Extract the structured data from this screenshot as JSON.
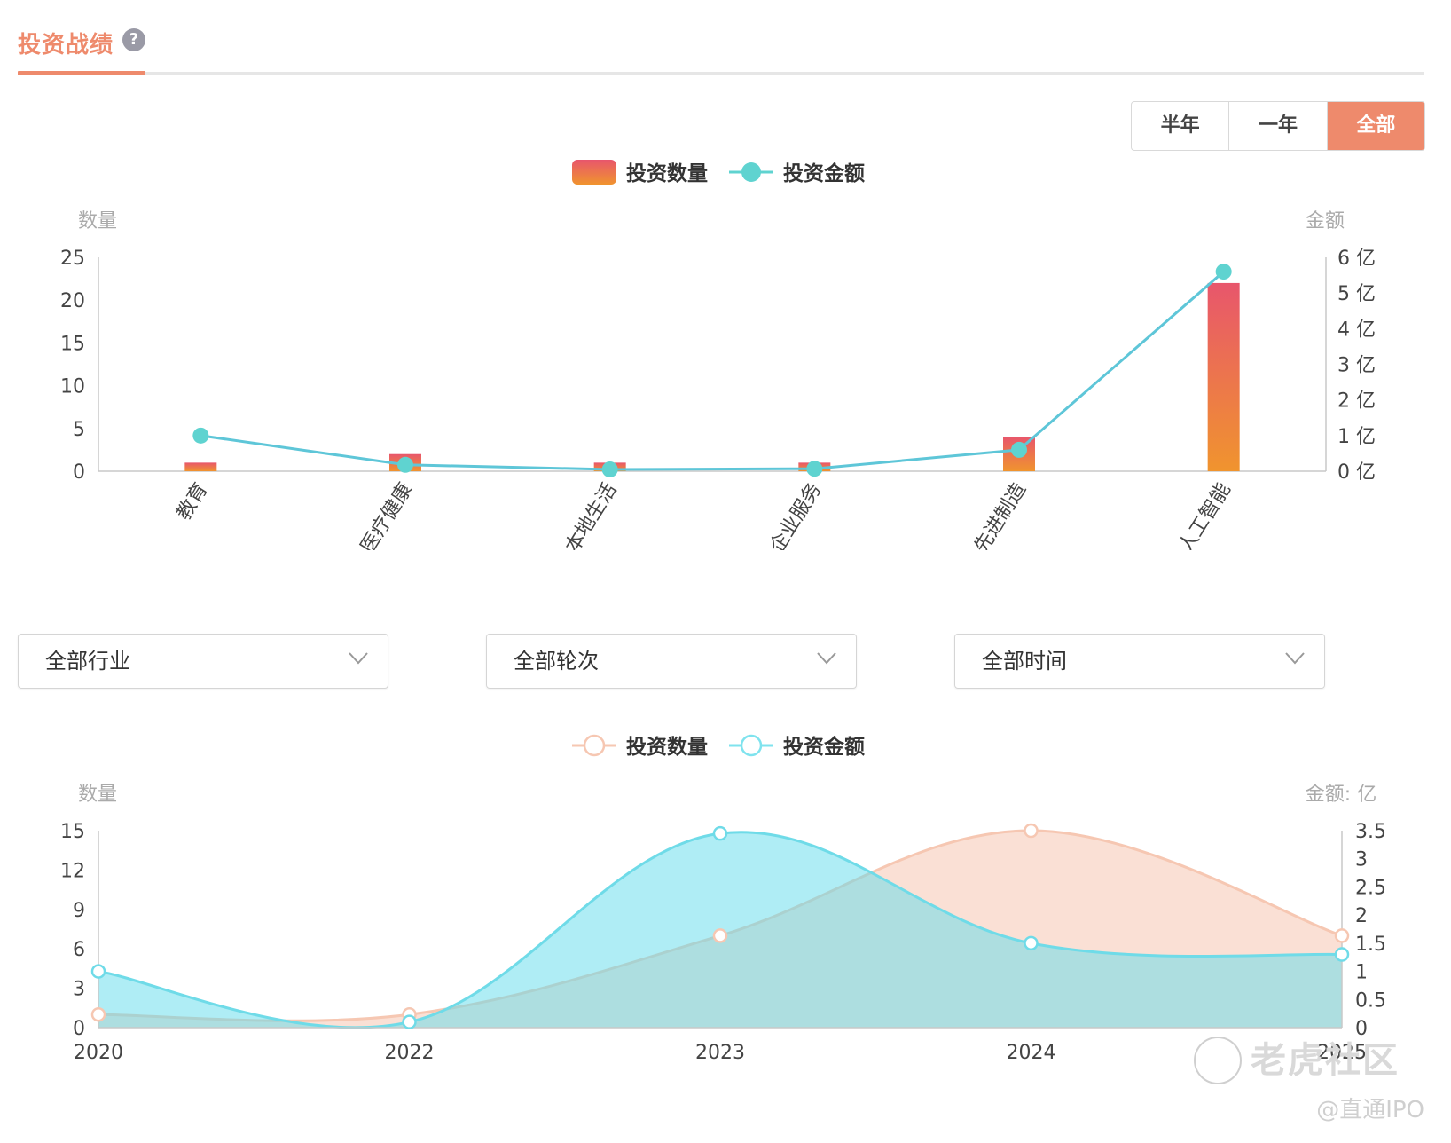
{
  "header": {
    "title": "投资战绩",
    "help_icon": "?"
  },
  "range_tabs": [
    {
      "label": "半年",
      "active": false
    },
    {
      "label": "一年",
      "active": false
    },
    {
      "label": "全部",
      "active": true
    }
  ],
  "filters": [
    {
      "label": "全部行业"
    },
    {
      "label": "全部轮次"
    },
    {
      "label": "全部时间"
    }
  ],
  "colors": {
    "accent": "#ee8a6c",
    "bar_top": "#e8566c",
    "bar_bottom": "#f0942e",
    "amount_line": "#5fd3d0",
    "count_area": "#f6c7b2",
    "amount_area": "#7fe3ee"
  },
  "watermark": {
    "brand": "老虎社区",
    "handle": "@直通IPO"
  },
  "chart_data": [
    {
      "type": "bar",
      "legend": [
        "投资数量",
        "投资金额"
      ],
      "ylabel_left": "数量",
      "ylabel_right": "金额",
      "ylim_left": [
        0,
        25
      ],
      "ylim_right": [
        0,
        6
      ],
      "left_ticks": [
        "0",
        "5",
        "10",
        "15",
        "20",
        "25"
      ],
      "right_ticks": [
        "0 亿",
        "1 亿",
        "2 亿",
        "3 亿",
        "4 亿",
        "5 亿",
        "6 亿"
      ],
      "categories": [
        "教育",
        "医疗健康",
        "本地生活",
        "企业服务",
        "先进制造",
        "人工智能"
      ],
      "series": [
        {
          "name": "投资数量",
          "type": "bar",
          "values": [
            1,
            2,
            1,
            1,
            4,
            22
          ]
        },
        {
          "name": "投资金额",
          "type": "line",
          "values": [
            1.0,
            0.18,
            0.05,
            0.07,
            0.6,
            5.6
          ]
        }
      ],
      "legend_position": "top-center",
      "grid": false
    },
    {
      "type": "area",
      "legend": [
        "投资数量",
        "投资金额"
      ],
      "ylabel_left": "数量",
      "ylabel_right": "金额: 亿",
      "ylim_left": [
        0,
        15
      ],
      "ylim_right": [
        0,
        3.5
      ],
      "left_ticks": [
        "0",
        "3",
        "6",
        "9",
        "12",
        "15"
      ],
      "right_ticks": [
        "0",
        "0.5",
        "1",
        "1.5",
        "2",
        "2.5",
        "3",
        "3.5"
      ],
      "x": [
        "2020",
        "2022",
        "2023",
        "2024",
        "2025"
      ],
      "series": [
        {
          "name": "投资数量",
          "values": [
            1,
            1,
            7,
            15,
            7
          ]
        },
        {
          "name": "投资金额",
          "values": [
            1.0,
            0.1,
            3.45,
            1.5,
            1.3
          ]
        }
      ],
      "legend_position": "top-center",
      "grid": false
    }
  ]
}
